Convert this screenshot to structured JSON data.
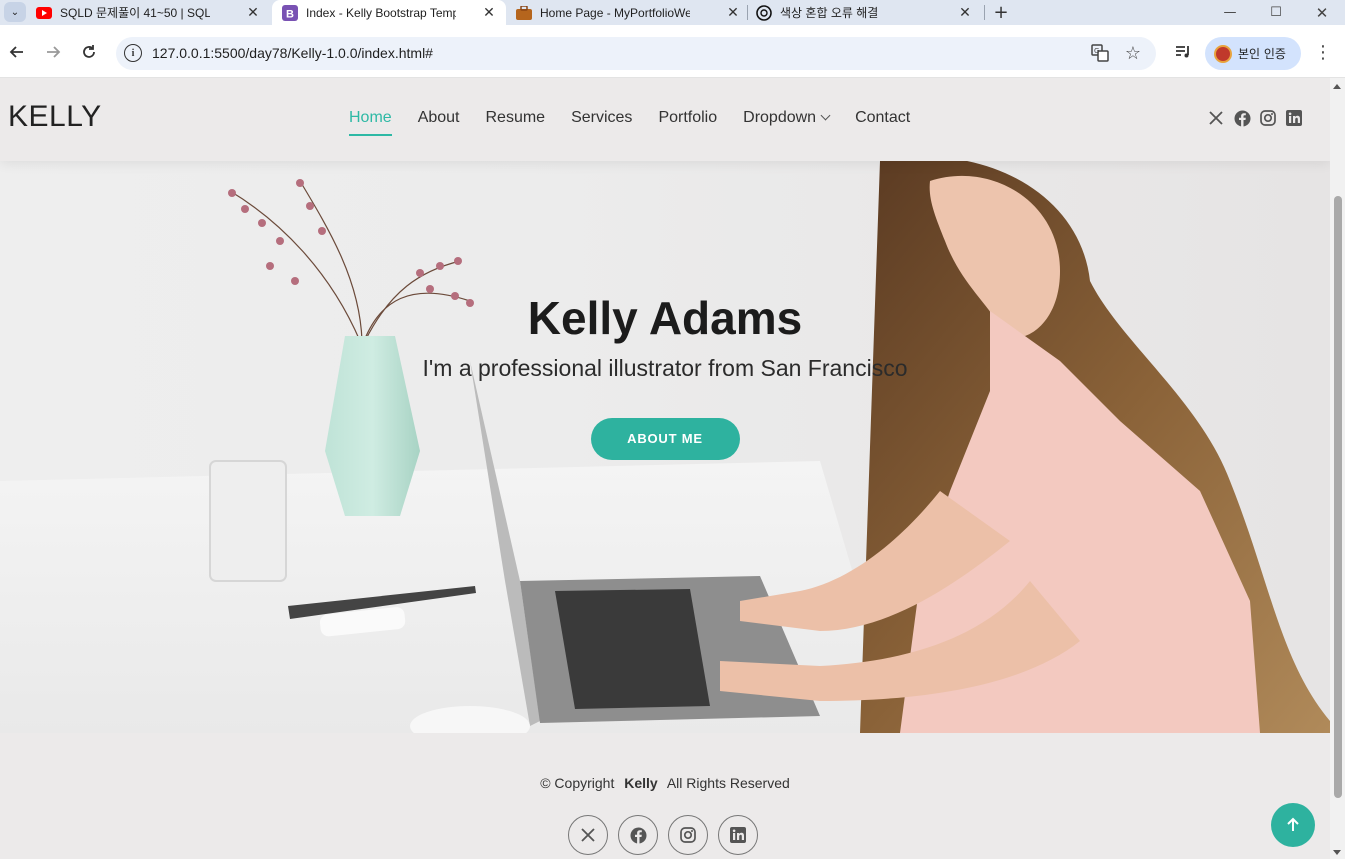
{
  "browser": {
    "tabs": [
      {
        "title": "SQLD 문제풀이 41~50 | SQLD",
        "icon": "youtube-icon",
        "active": false
      },
      {
        "title": "Index - Kelly Bootstrap Templa",
        "icon": "bootstrap-icon",
        "active": true
      },
      {
        "title": "Home Page - MyPortfolioWebs",
        "icon": "briefcase-icon",
        "active": false
      },
      {
        "title": "색상 혼합 오류 해결",
        "icon": "openai-icon",
        "active": false
      }
    ],
    "url": "127.0.0.1:5500/day78/Kelly-1.0.0/index.html#",
    "profile_label": "본인 인증"
  },
  "site": {
    "logo": "KELLY",
    "nav": [
      {
        "label": "Home",
        "active": true
      },
      {
        "label": "About"
      },
      {
        "label": "Resume"
      },
      {
        "label": "Services"
      },
      {
        "label": "Portfolio"
      },
      {
        "label": "Dropdown",
        "has_dropdown": true
      },
      {
        "label": "Contact"
      }
    ],
    "social": [
      "x-icon",
      "facebook-icon",
      "instagram-icon",
      "linkedin-icon"
    ]
  },
  "hero": {
    "name": "Kelly Adams",
    "subtitle": "I'm a professional illustrator from San Francisco",
    "button": "ABOUT ME"
  },
  "footer": {
    "copyright_prefix": "© Copyright",
    "brand": "Kelly",
    "rights": "All Rights Reserved"
  },
  "colors": {
    "accent": "#2eb29f",
    "page_bg": "#eceaea",
    "tab_strip": "#dfe6f1"
  }
}
